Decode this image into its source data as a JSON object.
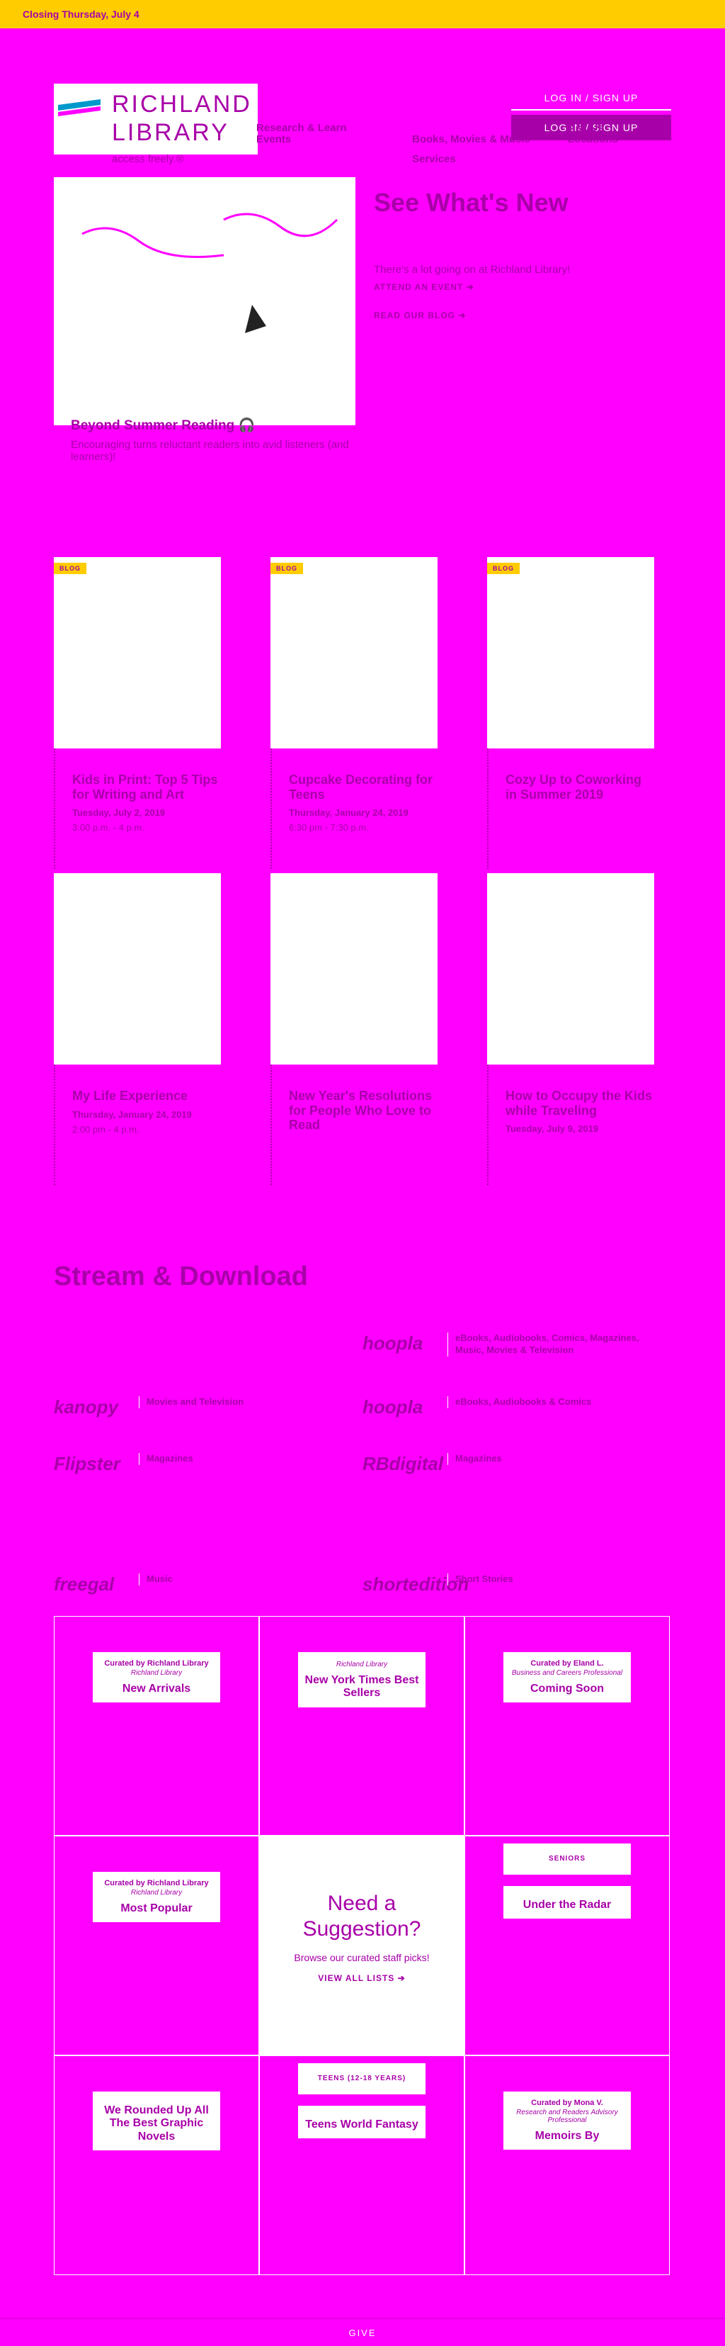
{
  "alert": {
    "text": "Closing Thursday, July 4"
  },
  "header": {
    "logo_line1": "RICHLAND",
    "logo_line2": "LIBRARY",
    "tagline": "access freely.®",
    "login_label": "LOG IN / SIGN UP",
    "login_label_2": "LOG IN / SIGN UP",
    "nav": [
      {
        "label": "Research & Learn"
      },
      {
        "label": "Events"
      },
      {
        "label": "Books, Movies & Music"
      },
      {
        "label": "Services"
      },
      {
        "label": "Ask Us"
      },
      {
        "label": "Locations"
      }
    ]
  },
  "hero": {
    "title": "See What's New",
    "subtitle": "There's a lot going on at Richland Library!",
    "attend_link": "ATTEND AN EVENT ➔",
    "blog_link": "READ OUR BLOG ➔",
    "caption_title": "Beyond Summer Reading 🎧",
    "caption_text": "Encouraging turns reluctant readers into avid listeners (and learners)!"
  },
  "events": [
    {
      "tag": "BLOG",
      "title": "Kids in Print: Top 5 Tips for Writing and Art",
      "date": "Tuesday, July 2, 2019",
      "time": "3:00 p.m. - 4 p.m."
    },
    {
      "tag": "BLOG",
      "title": "Cupcake Decorating for Teens",
      "date": "Thursday, January 24, 2019",
      "time": "6:30 pm - 7:30 p.m."
    },
    {
      "tag": "BLOG",
      "title": "Cozy Up to Coworking in Summer 2019",
      "date": "",
      "time": ""
    },
    {
      "tag": "",
      "title": "My Life Experience",
      "date": "Thursday, January 24, 2019",
      "time": "2:00 pm - 4 p.m."
    },
    {
      "tag": "",
      "title": "New Year's Resolutions for People Who Love to Read",
      "date": "",
      "time": ""
    },
    {
      "tag": "",
      "title": "How to Occupy the Kids while Traveling",
      "date": "Tuesday, July 9, 2019",
      "time": ""
    }
  ],
  "stream": {
    "title": "Stream & Download",
    "items": [
      {
        "logo": "hoopla",
        "desc": "eBooks, Audiobooks, Comics, Magazines, Music, Movies & Television"
      },
      {
        "logo": "kanopy",
        "desc": "Movies and Television"
      },
      {
        "logo": "hoopla",
        "desc": "eBooks, Audiobooks & Comics"
      },
      {
        "logo": "Flipster",
        "desc": "Magazines"
      },
      {
        "logo": "RBdigital",
        "desc": "Magazines"
      },
      {
        "logo": "freegal",
        "desc": "Music"
      },
      {
        "logo": "shortedition",
        "desc": "Short Stories"
      }
    ]
  },
  "lists": {
    "suggest_title_1": "Need a",
    "suggest_title_2": "Suggestion?",
    "suggest_text": "Browse our curated staff picks!",
    "suggest_btn": "VIEW ALL LISTS ➔",
    "tiles": [
      {
        "badge": "",
        "curated": "Curated by Richland Library",
        "who": "Richland Library",
        "title": "New Arrivals"
      },
      {
        "badge": "",
        "curated": "",
        "who": "Richland Library",
        "title": "New York Times Best Sellers"
      },
      {
        "badge": "",
        "curated": "Curated by Eland L.",
        "who": "Business and Careers Professional",
        "title": "Coming Soon"
      },
      {
        "badge": "",
        "curated": "Curated by Richland Library",
        "who": "Richland Library",
        "title": "Most Popular"
      },
      {
        "badge": "SENIORS",
        "curated": "",
        "who": "",
        "title": "Under the Radar"
      },
      {
        "badge": "",
        "curated": "",
        "who": "",
        "title": "We Rounded Up All The Best Graphic Novels"
      },
      {
        "badge": "TEENS (12-18 YEARS)",
        "curated": "",
        "who": "",
        "title": "Teens World Fantasy"
      },
      {
        "badge": "",
        "curated": "Curated by Mona V.",
        "who": "Research and Readers Advisory Professional",
        "title": "Memoirs By"
      }
    ]
  },
  "footer": {
    "give": "GIVE"
  },
  "colors": {
    "brand": "#a800a8",
    "alert": "#ffcc00",
    "bg": "#ff00ff"
  }
}
